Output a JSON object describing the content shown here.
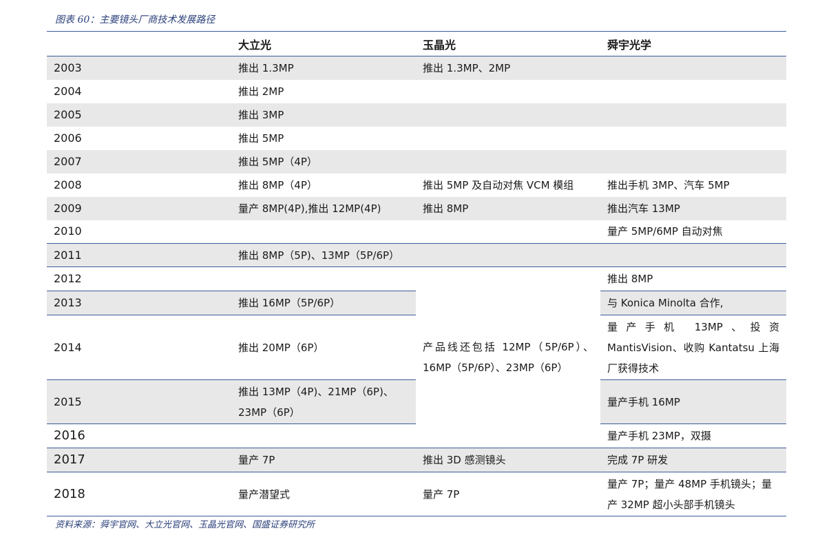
{
  "caption": "图表 60：主要镜头厂商技术发展路径",
  "headers": [
    "",
    "大立光",
    "玉晶光",
    "舜宇光学"
  ],
  "rows": [
    {
      "year": "2003",
      "a": "推出 1.3MP",
      "b": "推出 1.3MP、2MP",
      "c": ""
    },
    {
      "year": "2004",
      "a": "推出 2MP",
      "b": "",
      "c": ""
    },
    {
      "year": "2005",
      "a": "推出 3MP",
      "b": "",
      "c": ""
    },
    {
      "year": "2006",
      "a": "推出 5MP",
      "b": "",
      "c": ""
    },
    {
      "year": "2007",
      "a": "推出 5MP（4P）",
      "b": "",
      "c": ""
    },
    {
      "year": "2008",
      "a": "推出 8MP（4P）",
      "b": "推出 5MP 及自动对焦 VCM 模组",
      "c": "推出手机 3MP、汽车 5MP"
    },
    {
      "year": "2009",
      "a": "量产 8MP(4P),推出 12MP(4P)",
      "b": "推出 8MP",
      "c": "推出汽车 13MP"
    },
    {
      "year": "2010",
      "a": "",
      "b": "",
      "c": "量产 5MP/6MP 自动对焦"
    },
    {
      "year": "2011",
      "a": "推出 8MP（5P)、13MP（5P/6P）",
      "b": "",
      "c": ""
    },
    {
      "year": "2012",
      "a": "",
      "b": "产品线还包括 12MP（5P/6P）、16MP（5P/6P）、23MP（6P）",
      "c": "推出 8MP"
    },
    {
      "year": "2013",
      "a": "推出 16MP（5P/6P）",
      "c": "与 Konica Minolta 合作,"
    },
    {
      "year": "2014",
      "a": "推出 20MP（6P）",
      "c": "量产手机 13MP、投资 MantisVision、收购 Kantatsu 上海厂获得技术"
    },
    {
      "year": "2015",
      "a": "推出 13MP（4P)、21MP（6P)、23MP（6P）",
      "c": "量产手机 16MP"
    },
    {
      "year": "2016",
      "a": "",
      "c": "量产手机 23MP，双摄"
    },
    {
      "year": "2017",
      "a": "量产 7P",
      "b": "推出 3D 感测镜头",
      "c": "完成 7P 研发"
    },
    {
      "year": "2018",
      "a": "量产潜望式",
      "b": "量产 7P",
      "c": "量产 7P；量产 48MP 手机镜头；量产 32MP 超小头部手机镜头"
    }
  ],
  "source": "资料来源：舜宇官网、大立光官网、玉晶光官网、国盛证券研究所"
}
